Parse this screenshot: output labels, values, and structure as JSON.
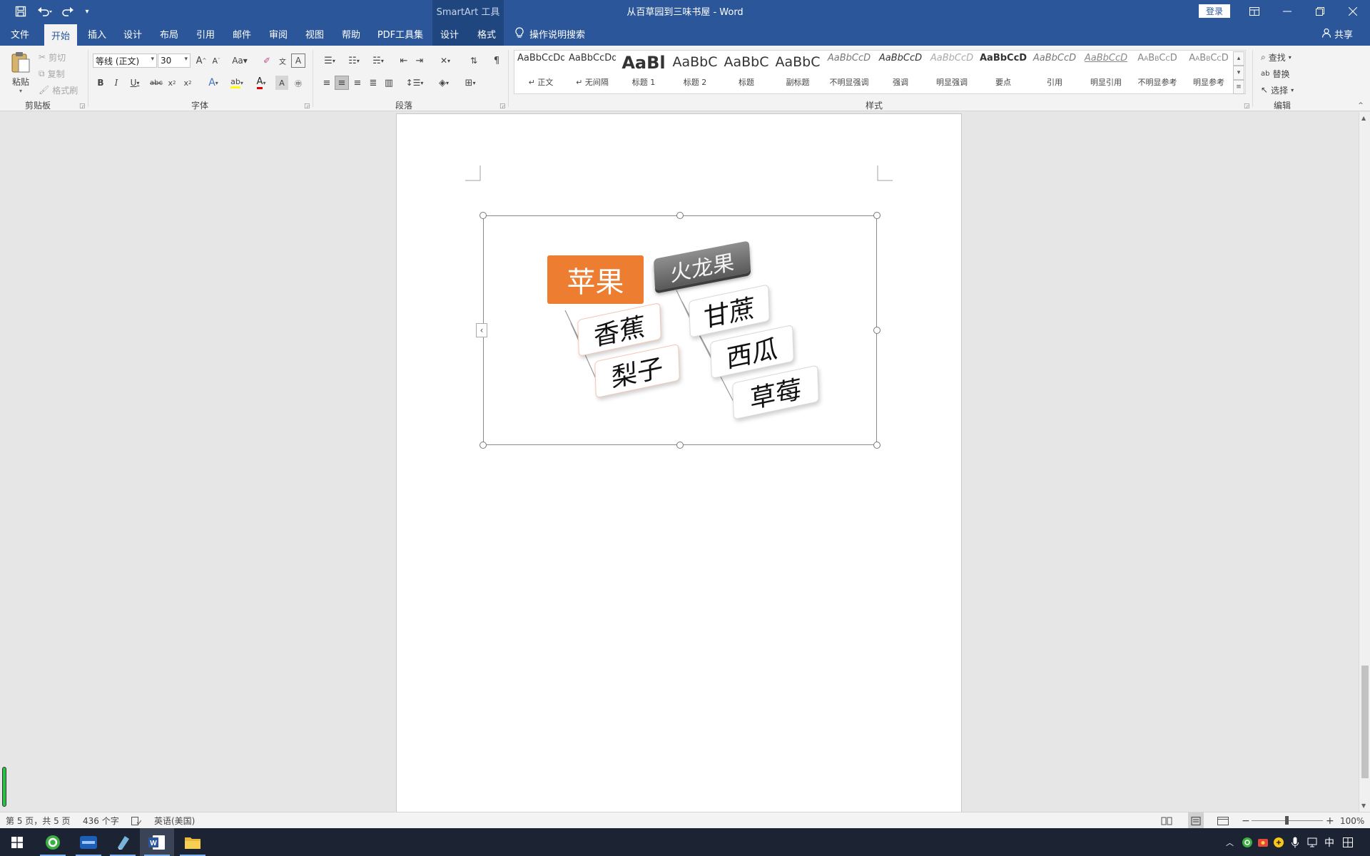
{
  "titlebar": {
    "context_tools": "SmartArt 工具",
    "doc_title": "从百草园到三味书屋  -  Word",
    "login": "登录",
    "quick_access": {
      "save_icon": "save-icon",
      "undo_icon": "undo-icon",
      "redo_icon": "redo-icon",
      "customize_icon": "customize-qat-icon"
    }
  },
  "menu": {
    "tabs": [
      "文件",
      "开始",
      "插入",
      "设计",
      "布局",
      "引用",
      "邮件",
      "审阅",
      "视图",
      "帮助",
      "PDF工具集",
      "设计",
      "格式"
    ],
    "active_tab": "开始",
    "tell_me": "操作说明搜索",
    "share": "共享"
  },
  "ribbon": {
    "clipboard": {
      "label": "剪贴板",
      "paste": "粘贴",
      "cut": "剪切",
      "copy": "复制",
      "format_painter": "格式刷"
    },
    "font": {
      "label": "字体",
      "font_name": "等线 (正文)",
      "font_size": "30",
      "font_color": "#e00000",
      "highlight_color": "#ffff00"
    },
    "paragraph": {
      "label": "段落"
    },
    "styles": {
      "label": "样式",
      "items": [
        {
          "preview": "AaBbCcDd",
          "name": "↵ 正文"
        },
        {
          "preview": "AaBbCcDd",
          "name": "↵ 无间隔"
        },
        {
          "preview": "AaBl",
          "name": "标题 1"
        },
        {
          "preview": "AaBbC",
          "name": "标题 2"
        },
        {
          "preview": "AaBbC",
          "name": "标题"
        },
        {
          "preview": "AaBbC",
          "name": "副标题"
        },
        {
          "preview": "AaBbCcD",
          "name": "不明显强调"
        },
        {
          "preview": "AaBbCcD",
          "name": "强调"
        },
        {
          "preview": "AaBbCcD",
          "name": "明显强调"
        },
        {
          "preview": "AaBbCcD",
          "name": "要点"
        },
        {
          "preview": "AaBbCcD",
          "name": "引用"
        },
        {
          "preview": "AaBbCcD",
          "name": "明显引用"
        },
        {
          "preview": "AaBbCcD",
          "name": "不明显参考"
        },
        {
          "preview": "AaBbCcD",
          "name": "明显参考"
        }
      ]
    },
    "editing": {
      "label": "编辑",
      "find": "查找",
      "replace": "替换",
      "select": "选择"
    }
  },
  "smartart": {
    "nodes": {
      "apple": "苹果",
      "dragonfruit": "火龙果",
      "banana": "香蕉",
      "pear": "梨子",
      "sugarcane": "甘蔗",
      "watermelon": "西瓜",
      "strawberry": "草莓"
    },
    "accent_color": "#ed7d31"
  },
  "statusbar": {
    "page": "第 5 页，共 5 页",
    "words": "436 个字",
    "language": "英语(美国)",
    "zoom": "100%"
  },
  "taskbar": {
    "tray_ime": "中"
  }
}
